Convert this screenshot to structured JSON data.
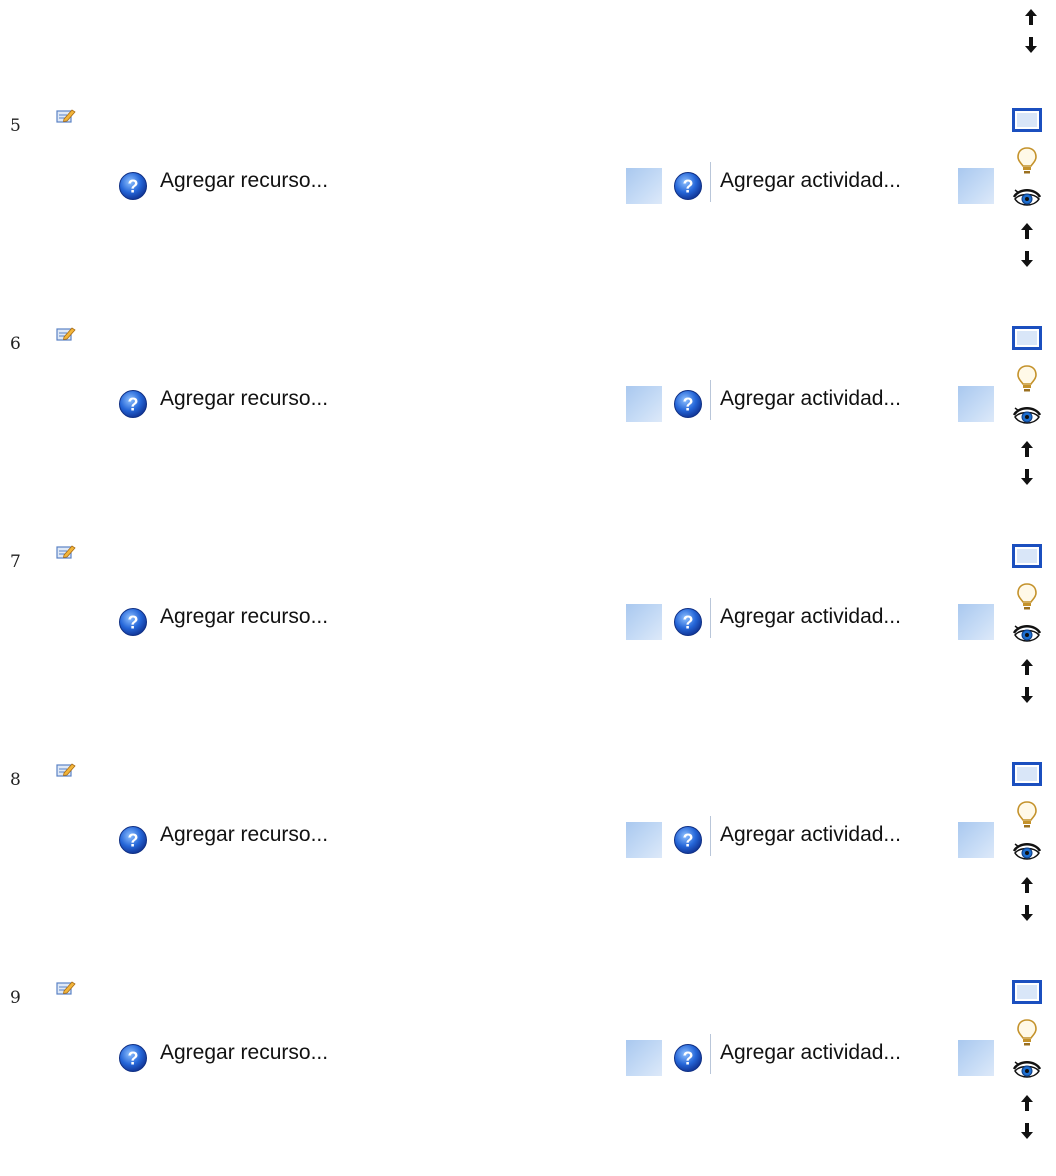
{
  "top_controls": {
    "icons": [
      "move-up-arrow-icon",
      "move-down-arrow-icon"
    ]
  },
  "sections": [
    {
      "number": "5",
      "add_resource_label": "Agregar recurso...",
      "add_activity_label": "Agregar actividad..."
    },
    {
      "number": "6",
      "add_resource_label": "Agregar recurso...",
      "add_activity_label": "Agregar actividad..."
    },
    {
      "number": "7",
      "add_resource_label": "Agregar recurso...",
      "add_activity_label": "Agregar actividad..."
    },
    {
      "number": "8",
      "add_resource_label": "Agregar recurso...",
      "add_activity_label": "Agregar actividad..."
    },
    {
      "number": "9",
      "add_resource_label": "Agregar recurso...",
      "add_activity_label": "Agregar actividad..."
    }
  ],
  "section_control_icons": [
    "show-only-this-section-icon",
    "highlight-lightbulb-icon",
    "visibility-eye-icon",
    "move-up-arrow-icon",
    "move-down-arrow-icon"
  ],
  "colors": {
    "help_icon_blue": "#1f5fd0",
    "select_box_blue": "#b7d0f2",
    "eye_iris": "#1e6fd0"
  }
}
